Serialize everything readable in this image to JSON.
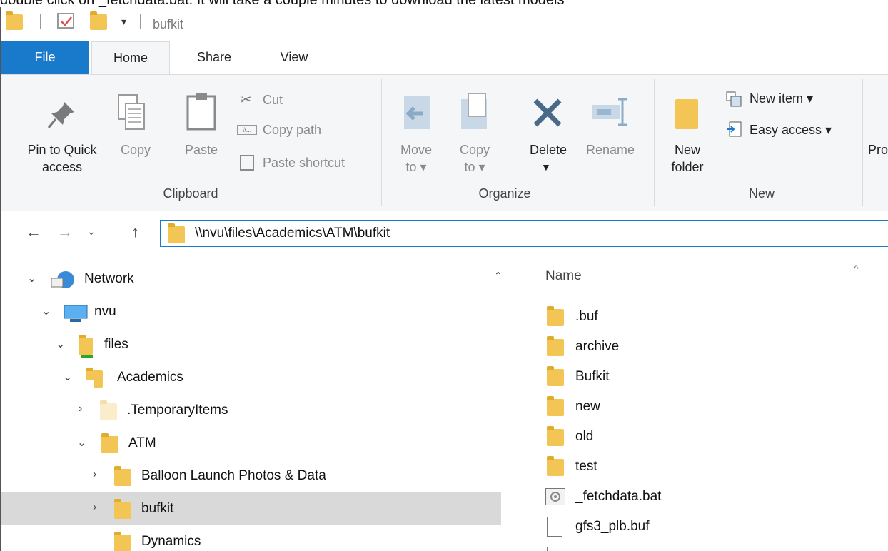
{
  "above_text": "double click on _fetchdata.bat. It will take a couple minutes to download the latest models",
  "window": {
    "title": "bufkit"
  },
  "tabs": [
    "File",
    "Home",
    "Share",
    "View"
  ],
  "ribbon": {
    "clipboard": {
      "pin_label_1": "Pin to Quick",
      "pin_label_2": "access",
      "copy": "Copy",
      "paste": "Paste",
      "cut": "Cut",
      "copy_path": "Copy path",
      "paste_shortcut": "Paste shortcut",
      "group": "Clipboard"
    },
    "organize": {
      "move_to_1": "Move",
      "move_to_2": "to ▾",
      "copy_to_1": "Copy",
      "copy_to_2": "to ▾",
      "delete": "Delete",
      "rename": "Rename",
      "group": "Organize"
    },
    "new": {
      "new_folder_1": "New",
      "new_folder_2": "folder",
      "new_item": "New item ▾",
      "easy_access": "Easy access ▾",
      "group": "New"
    },
    "partial_next": "Pro"
  },
  "address": {
    "path": "\\\\nvu\\files\\Academics\\ATM\\bufkit"
  },
  "nav_tree": [
    {
      "label": "Network",
      "state": "expanded"
    },
    {
      "label": "nvu",
      "state": "expanded"
    },
    {
      "label": "files",
      "state": "expanded"
    },
    {
      "label": "Academics",
      "state": "expanded"
    },
    {
      "label": ".TemporaryItems",
      "state": "collapsed"
    },
    {
      "label": "ATM",
      "state": "expanded"
    },
    {
      "label": "Balloon Launch Photos & Data",
      "state": "collapsed"
    },
    {
      "label": "bufkit",
      "state": "collapsed",
      "selected": true
    },
    {
      "label": "Dynamics",
      "state": "none"
    }
  ],
  "file_list": {
    "column": "Name",
    "items": [
      {
        "name": ".buf",
        "type": "folder"
      },
      {
        "name": "archive",
        "type": "folder"
      },
      {
        "name": "Bufkit",
        "type": "folder"
      },
      {
        "name": "new",
        "type": "folder"
      },
      {
        "name": "old",
        "type": "folder"
      },
      {
        "name": "test",
        "type": "folder"
      },
      {
        "name": "_fetchdata.bat",
        "type": "batch"
      },
      {
        "name": "gfs3_plb.buf",
        "type": "file"
      },
      {
        "name": "",
        "type": "file"
      }
    ]
  },
  "colors": {
    "accent": "#1979ca",
    "folder": "#f3c555",
    "selection": "#d9d9d9"
  }
}
